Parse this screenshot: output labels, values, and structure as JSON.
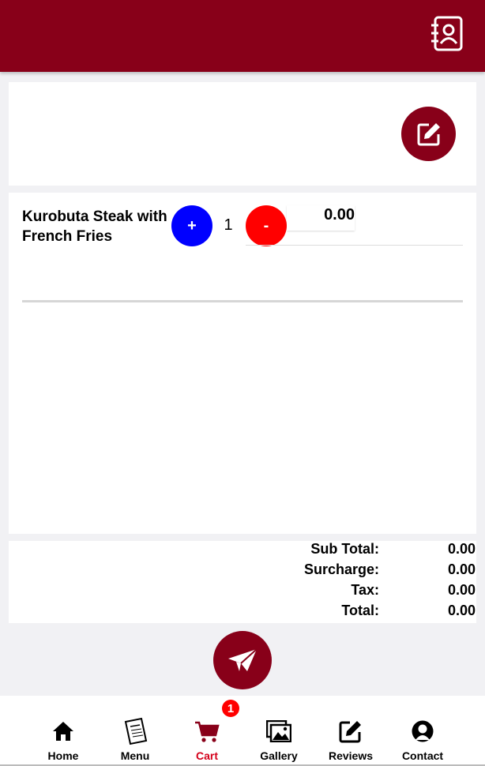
{
  "header": {
    "contact_icon": "contact-book-icon"
  },
  "cart_item": {
    "name": "Kurobuta Steak with French Fries",
    "plus_label": "+",
    "minus_label": "-",
    "quantity": "1",
    "price": "0.00"
  },
  "totals": [
    {
      "label": "Sub Total:",
      "value": "0.00"
    },
    {
      "label": "Surcharge:",
      "value": "0.00"
    },
    {
      "label": "Tax:",
      "value": "0.00"
    },
    {
      "label": "Total:",
      "value": "0.00"
    }
  ],
  "nav": {
    "items": [
      {
        "label": "Home",
        "icon": "home-icon"
      },
      {
        "label": "Menu",
        "icon": "menu-book-icon"
      },
      {
        "label": "Cart",
        "icon": "cart-icon"
      },
      {
        "label": "Gallery",
        "icon": "gallery-icon"
      },
      {
        "label": "Reviews",
        "icon": "reviews-icon"
      },
      {
        "label": "Contact",
        "icon": "contact-icon"
      }
    ],
    "active": "Cart",
    "cart_badge": "1"
  },
  "colors": {
    "brand": "#880019",
    "plus_button": "#0000ff",
    "minus_button": "#ff0000",
    "active_nav": "#d4001a"
  }
}
